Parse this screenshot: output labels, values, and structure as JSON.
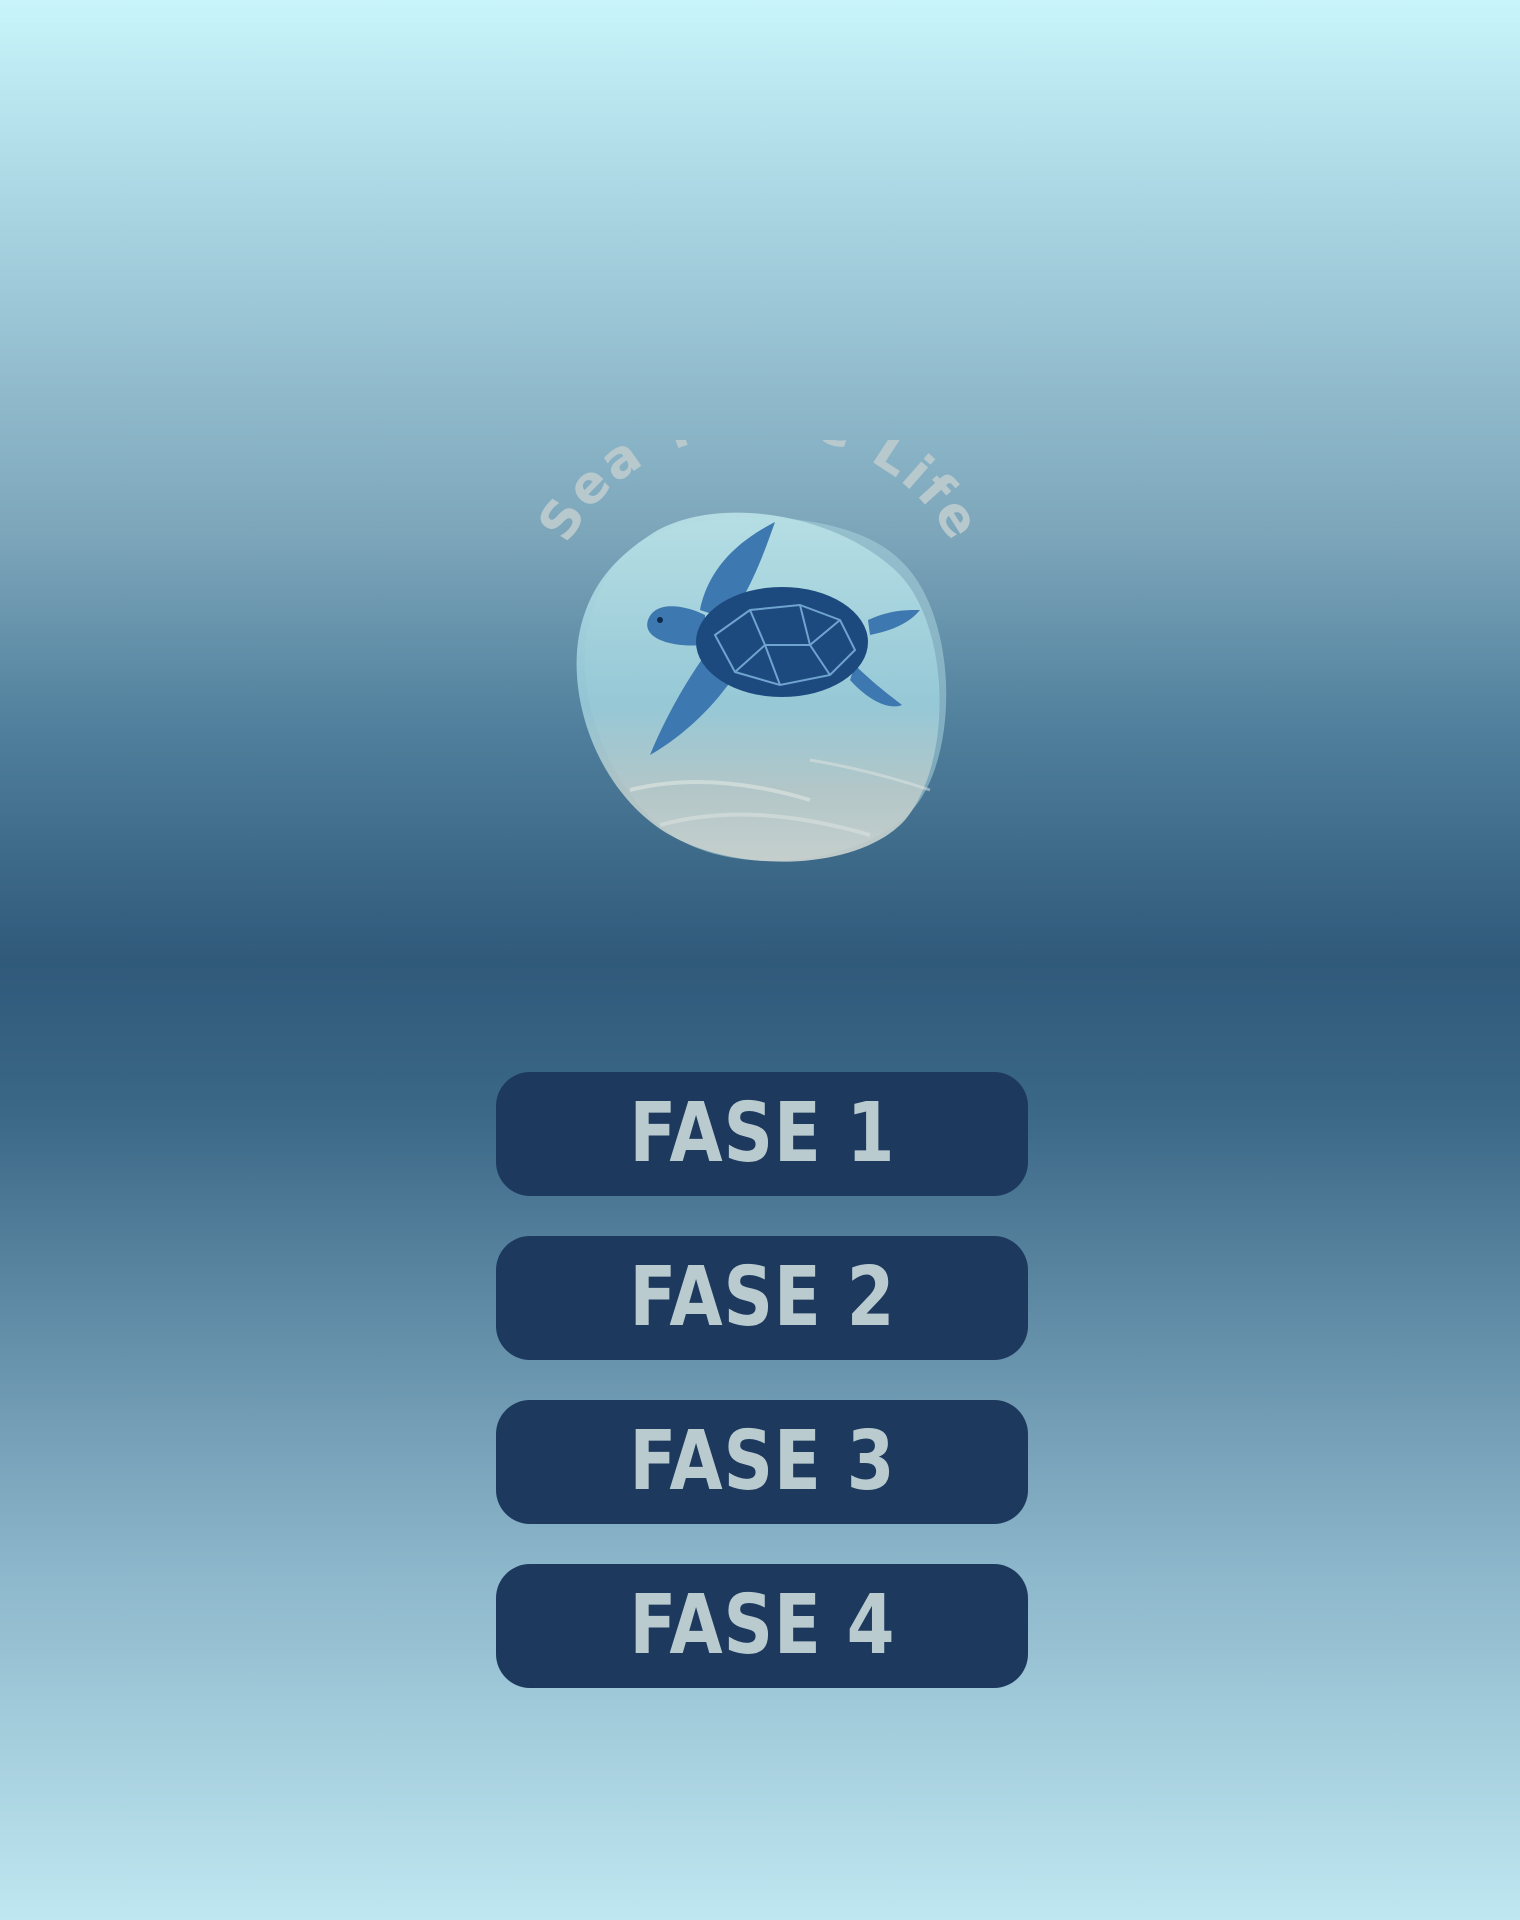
{
  "logo": {
    "title": "Sea Turtle Life",
    "icon": "sea-turtle-icon"
  },
  "menu": {
    "stages": [
      {
        "label": "FASE 1"
      },
      {
        "label": "FASE 2"
      },
      {
        "label": "FASE 3"
      },
      {
        "label": "FASE 4"
      }
    ]
  },
  "colors": {
    "button_bg": "#1d3a5e",
    "button_text": "#b9cbcf",
    "logo_text": "#b8c9cd",
    "turtle_shell": "#1d4a7e",
    "turtle_skin": "#3d78b0"
  }
}
